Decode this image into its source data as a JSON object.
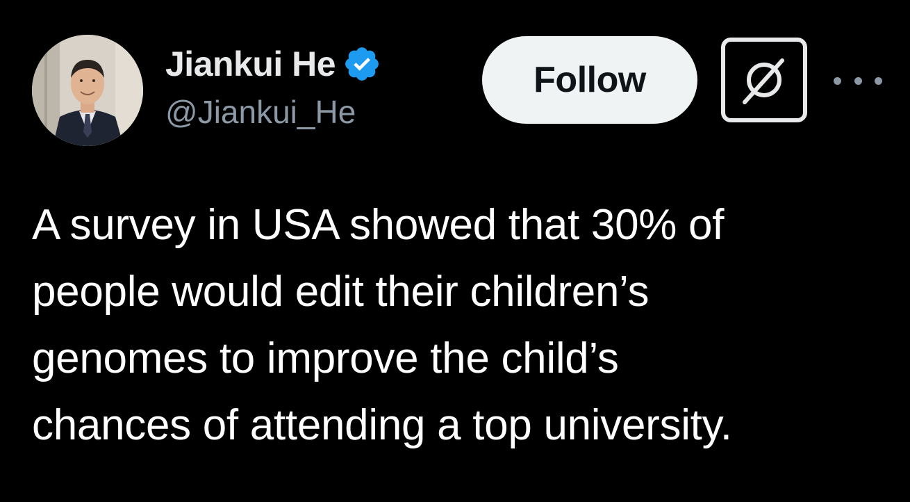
{
  "author": {
    "display_name": "Jiankui He",
    "handle": "@Jiankui_He",
    "verified_icon": "verified-badge-icon",
    "verified_color": "#1d9bf0"
  },
  "actions": {
    "follow_label": "Follow",
    "grok_icon": "grok-icon",
    "more_icon": "more-options-icon"
  },
  "tweet": {
    "text": "A survey in USA showed that 30% of\npeople would edit their children’s\ngenomes to improve the child’s\nchances of attending a top university."
  },
  "colors": {
    "background": "#000000",
    "text_primary": "#e7e9ea",
    "text_secondary": "#8b98a5",
    "follow_bg": "#eff3f4"
  }
}
